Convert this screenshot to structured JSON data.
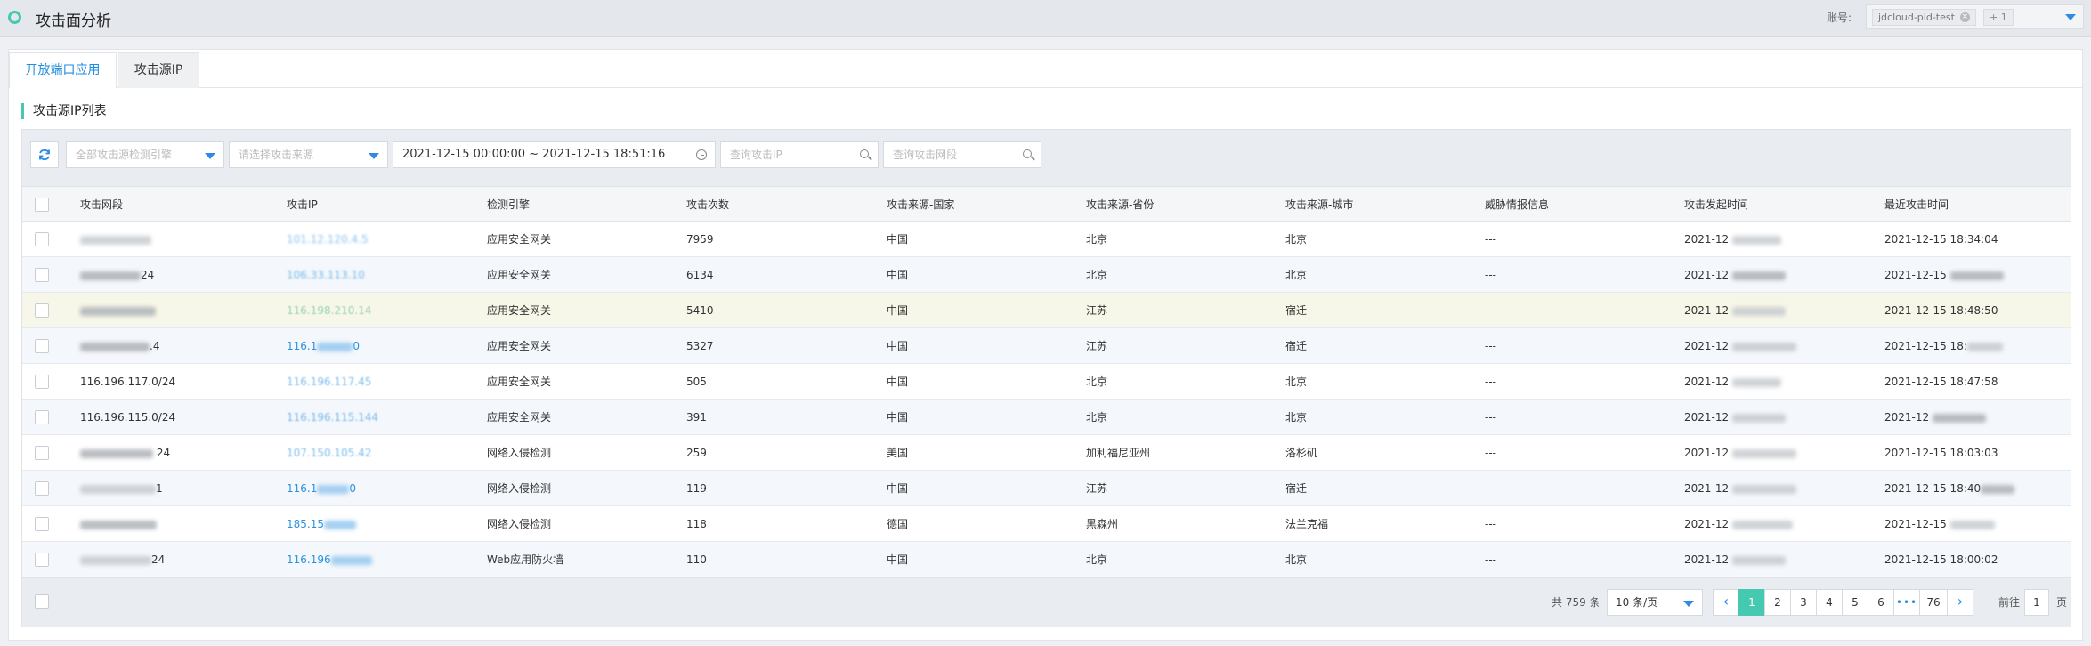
{
  "header": {
    "title": "攻击面分析",
    "account_label": "账号:",
    "account_tag": "jdcloud-pid-test",
    "account_more": "+ 1"
  },
  "tabs": [
    {
      "label": "开放端口应用"
    },
    {
      "label": "攻击源IP"
    }
  ],
  "section_title": "攻击源IP列表",
  "filters": {
    "engine_placeholder": "全部攻击源检测引擎",
    "source_placeholder": "请选择攻击来源",
    "date_range": "2021-12-15 00:00:00 ~ 2021-12-15 18:51:16",
    "ip_placeholder": "查询攻击IP",
    "segment_placeholder": "查询攻击网段"
  },
  "columns": [
    "攻击网段",
    "攻击IP",
    "检测引擎",
    "攻击次数",
    "攻击来源-国家",
    "攻击来源-省份",
    "攻击来源-城市",
    "威胁情报信息",
    "攻击发起时间",
    "最近攻击时间"
  ],
  "rows": [
    {
      "segment": "101.12.120.0/24",
      "ip": "101.12.120.4.5",
      "engine": "应用安全网关",
      "count": "7959",
      "country": "中国",
      "province": "北京",
      "city": "北京",
      "intel": "---",
      "start": "2021-12",
      "last": "2021-12-15 18:34:04"
    },
    {
      "segment": "24",
      "ip": "106.33.113.10",
      "engine": "应用安全网关",
      "count": "6134",
      "country": "中国",
      "province": "北京",
      "city": "北京",
      "intel": "---",
      "start": "2021-12",
      "last": "2021-12-15"
    },
    {
      "segment": "116.198.120.0/24",
      "ip": "116.198.210.14",
      "engine": "应用安全网关",
      "count": "5410",
      "country": "中国",
      "province": "江苏",
      "city": "宿迁",
      "intel": "---",
      "start": "2021-12",
      "last": "2021-12-15 18:48:50"
    },
    {
      "segment": ".4",
      "ip": "116.1",
      "ip_tail": "0",
      "engine": "应用安全网关",
      "count": "5327",
      "country": "中国",
      "province": "江苏",
      "city": "宿迁",
      "intel": "---",
      "start": "2021-12",
      "last": "2021-12-15 18:"
    },
    {
      "segment": "116.196.117.0/24",
      "ip": "116.196.117.45",
      "engine": "应用安全网关",
      "count": "505",
      "country": "中国",
      "province": "北京",
      "city": "北京",
      "intel": "---",
      "start": "2021-12",
      "last": "2021-12-15 18:47:58"
    },
    {
      "segment": "116.196.115.0/24",
      "ip": "116.196.115.144",
      "engine": "应用安全网关",
      "count": "391",
      "country": "中国",
      "province": "北京",
      "city": "北京",
      "intel": "---",
      "start": "2021-12",
      "last": "2021-12"
    },
    {
      "segment": "24",
      "ip": "107.150.105.42",
      "engine": "网络入侵检测",
      "count": "259",
      "country": "美国",
      "province": "加利福尼亚州",
      "city": "洛杉矶",
      "intel": "---",
      "start": "2021-12",
      "last": "2021-12-15 18:03:03"
    },
    {
      "segment": "1",
      "ip": "116.1",
      "ip_tail": "0",
      "engine": "网络入侵检测",
      "count": "119",
      "country": "中国",
      "province": "江苏",
      "city": "宿迁",
      "intel": "---",
      "start": "2021-12",
      "last": "2021-12-15 18:40"
    },
    {
      "segment": "",
      "ip": "185.15",
      "engine": "网络入侵检测",
      "count": "118",
      "country": "德国",
      "province": "黑森州",
      "city": "法兰克福",
      "intel": "---",
      "start": "2021-12",
      "last": "2021-12-15"
    },
    {
      "segment": "24",
      "ip": "116.196",
      "engine": "Web应用防火墙",
      "count": "110",
      "country": "中国",
      "province": "北京",
      "city": "北京",
      "intel": "---",
      "start": "2021-12",
      "last": "2021-12-15 18:00:02"
    }
  ],
  "footer": {
    "total": "共 759 条",
    "per_page": "10 条/页",
    "pages": [
      "1",
      "2",
      "3",
      "4",
      "5",
      "6",
      "•••",
      "76"
    ],
    "goto_label": "前往",
    "goto_value": "1",
    "goto_unit": "页"
  },
  "colors": {
    "accent": "#45c9b0",
    "link": "#2a92e0",
    "highlight_row": "#f7f7e9"
  }
}
